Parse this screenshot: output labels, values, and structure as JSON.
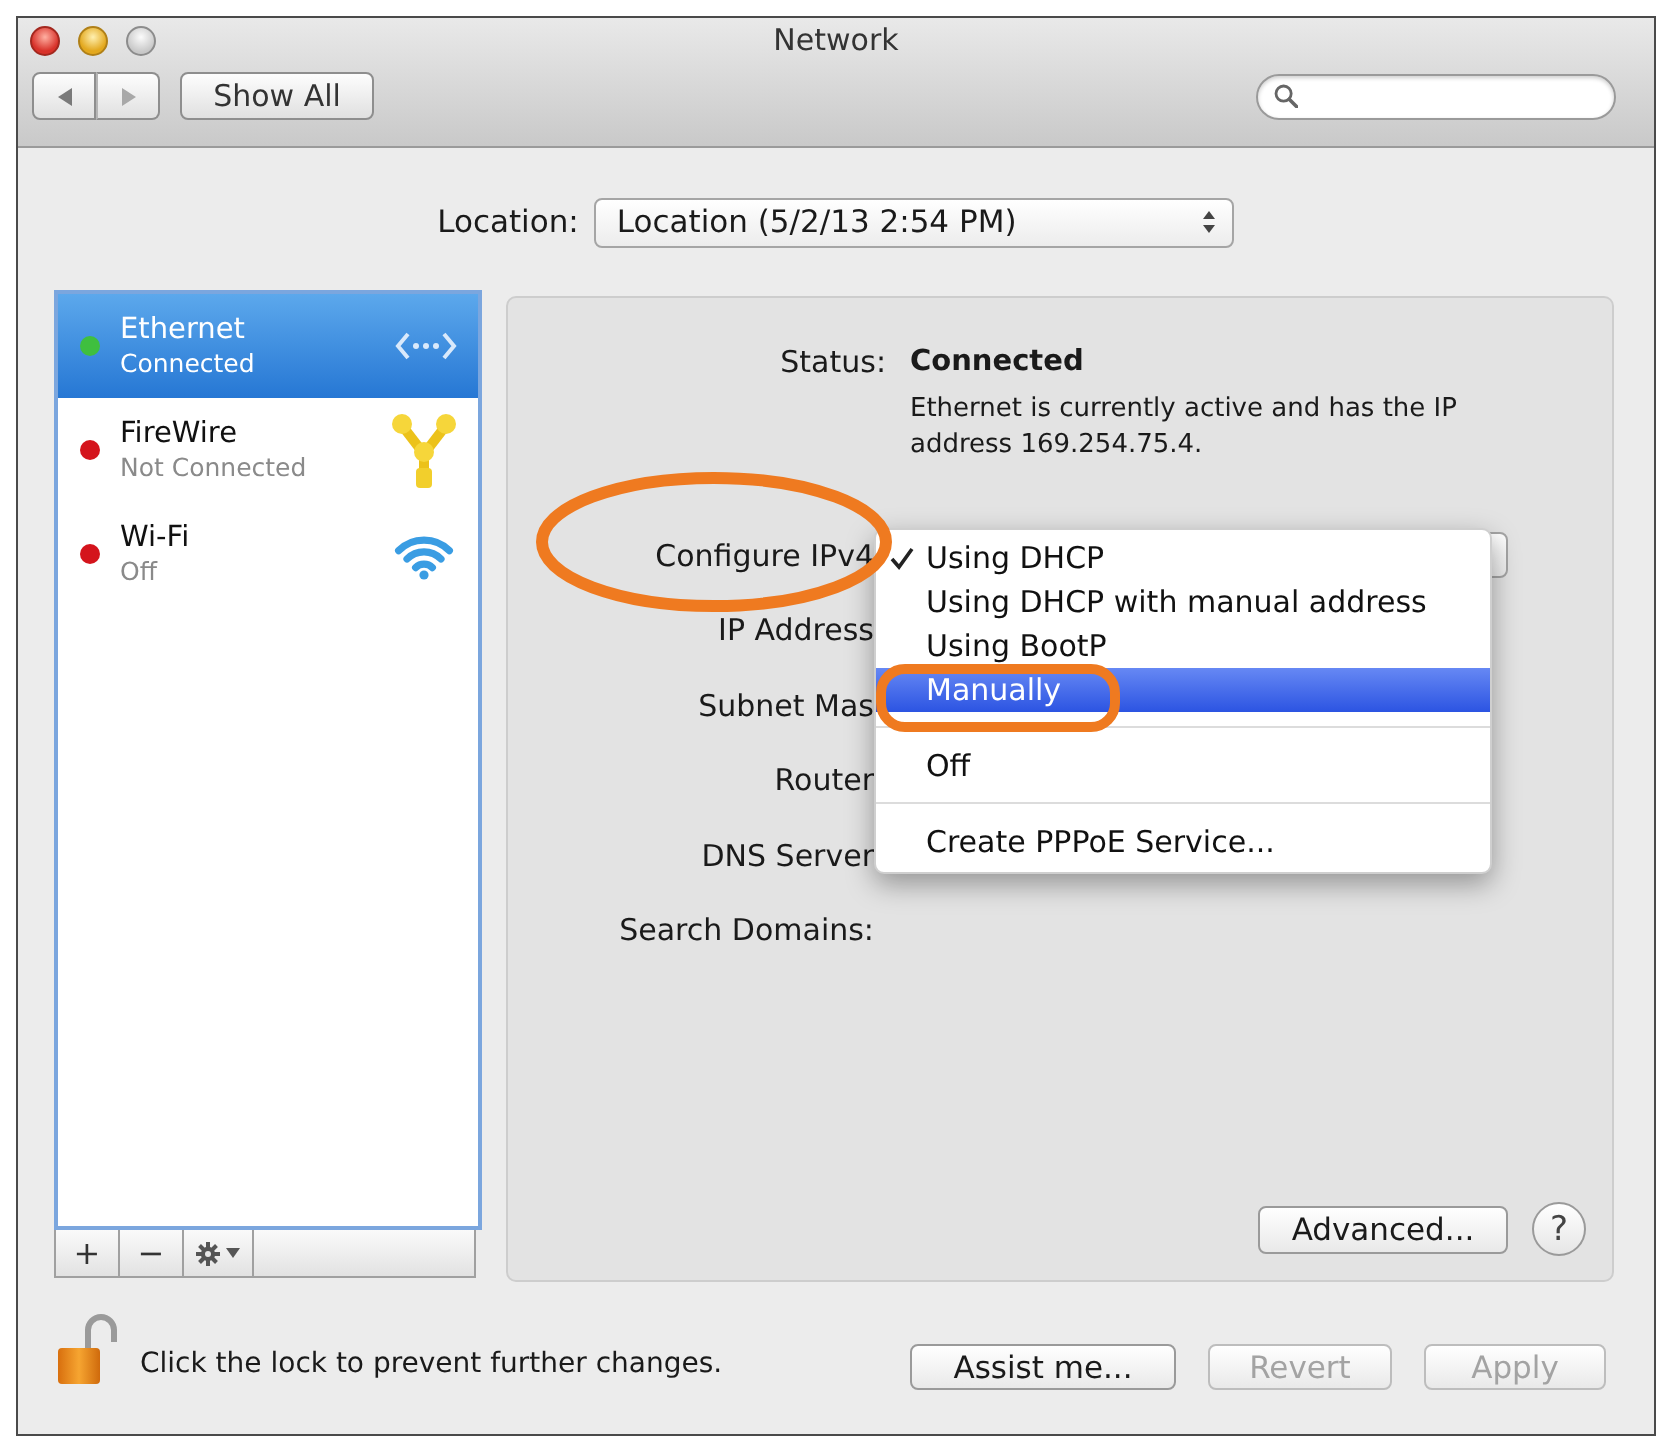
{
  "window": {
    "title": "Network"
  },
  "toolbar": {
    "show_all": "Show All"
  },
  "location": {
    "label": "Location:",
    "value": "Location (5/2/13 2:54 PM)"
  },
  "services": [
    {
      "kind": "ethernet",
      "name": "Ethernet",
      "status": "Connected",
      "color": "#3fbf3f",
      "selected": true
    },
    {
      "kind": "firewire",
      "name": "FireWire",
      "status": "Not Connected",
      "color": "#d4141c",
      "selected": false
    },
    {
      "kind": "wifi",
      "name": "Wi-Fi",
      "status": "Off",
      "color": "#d4141c",
      "selected": false
    }
  ],
  "service_buttons": [
    "+",
    "−"
  ],
  "detail": {
    "status_label": "Status:",
    "status_value": "Connected",
    "status_description": "Ethernet is currently active and has the IP address 169.254.75.4.",
    "fields": [
      {
        "kind": "popup",
        "label": "Configure IPv4"
      },
      {
        "kind": "text",
        "label": "IP Address"
      },
      {
        "kind": "text",
        "label": "Subnet Mas"
      },
      {
        "kind": "text",
        "label": "Router"
      },
      {
        "kind": "text",
        "label": "DNS Server"
      },
      {
        "kind": "text",
        "label": "Search Domains:"
      }
    ],
    "advanced_button": "Advanced...",
    "help_button": "?"
  },
  "configure_menu": [
    {
      "kind": "item",
      "label": "Using DHCP",
      "checked": true,
      "selected": false
    },
    {
      "kind": "item",
      "label": "Using DHCP with manual address",
      "checked": false,
      "selected": false
    },
    {
      "kind": "item",
      "label": "Using BootP",
      "checked": false,
      "selected": false
    },
    {
      "kind": "item",
      "label": "Manually",
      "checked": false,
      "selected": true
    },
    {
      "kind": "separator"
    },
    {
      "kind": "item",
      "label": "Off",
      "checked": false,
      "selected": false
    },
    {
      "kind": "separator"
    },
    {
      "kind": "item",
      "label": "Create PPPoE Service...",
      "checked": false,
      "selected": false
    }
  ],
  "footer": {
    "lock_message": "Click the lock to prevent further changes.",
    "buttons": [
      {
        "label": "Assist me...",
        "disabled": false
      },
      {
        "label": "Revert",
        "disabled": true
      },
      {
        "label": "Apply",
        "disabled": true
      }
    ]
  }
}
